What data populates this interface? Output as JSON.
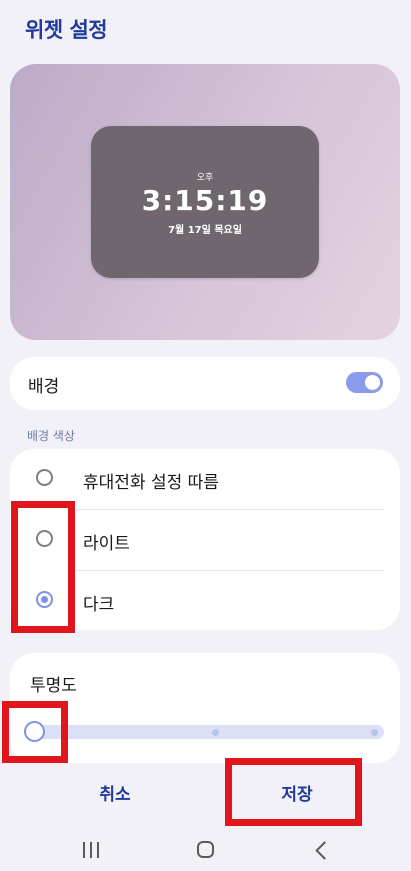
{
  "header": {
    "title": "위젯 설정"
  },
  "preview": {
    "ampm": "오후",
    "time": "3:15:19",
    "date": "7월 17일 목요일"
  },
  "background": {
    "label": "배경",
    "toggle_on": true
  },
  "background_color": {
    "section_label": "배경 색상",
    "options": [
      {
        "label": "휴대전화 설정 따름",
        "selected": false
      },
      {
        "label": "라이트",
        "selected": false
      },
      {
        "label": "다크",
        "selected": true
      }
    ]
  },
  "opacity": {
    "label": "투명도",
    "value_fraction": 0
  },
  "actions": {
    "cancel": "취소",
    "save": "저장"
  },
  "colors": {
    "accent": "#7f91e6",
    "title": "#213a9c",
    "highlight": "#e0161c"
  },
  "nav": {
    "recent_icon": "recent-apps-icon",
    "home_icon": "home-icon",
    "back_icon": "back-icon"
  }
}
